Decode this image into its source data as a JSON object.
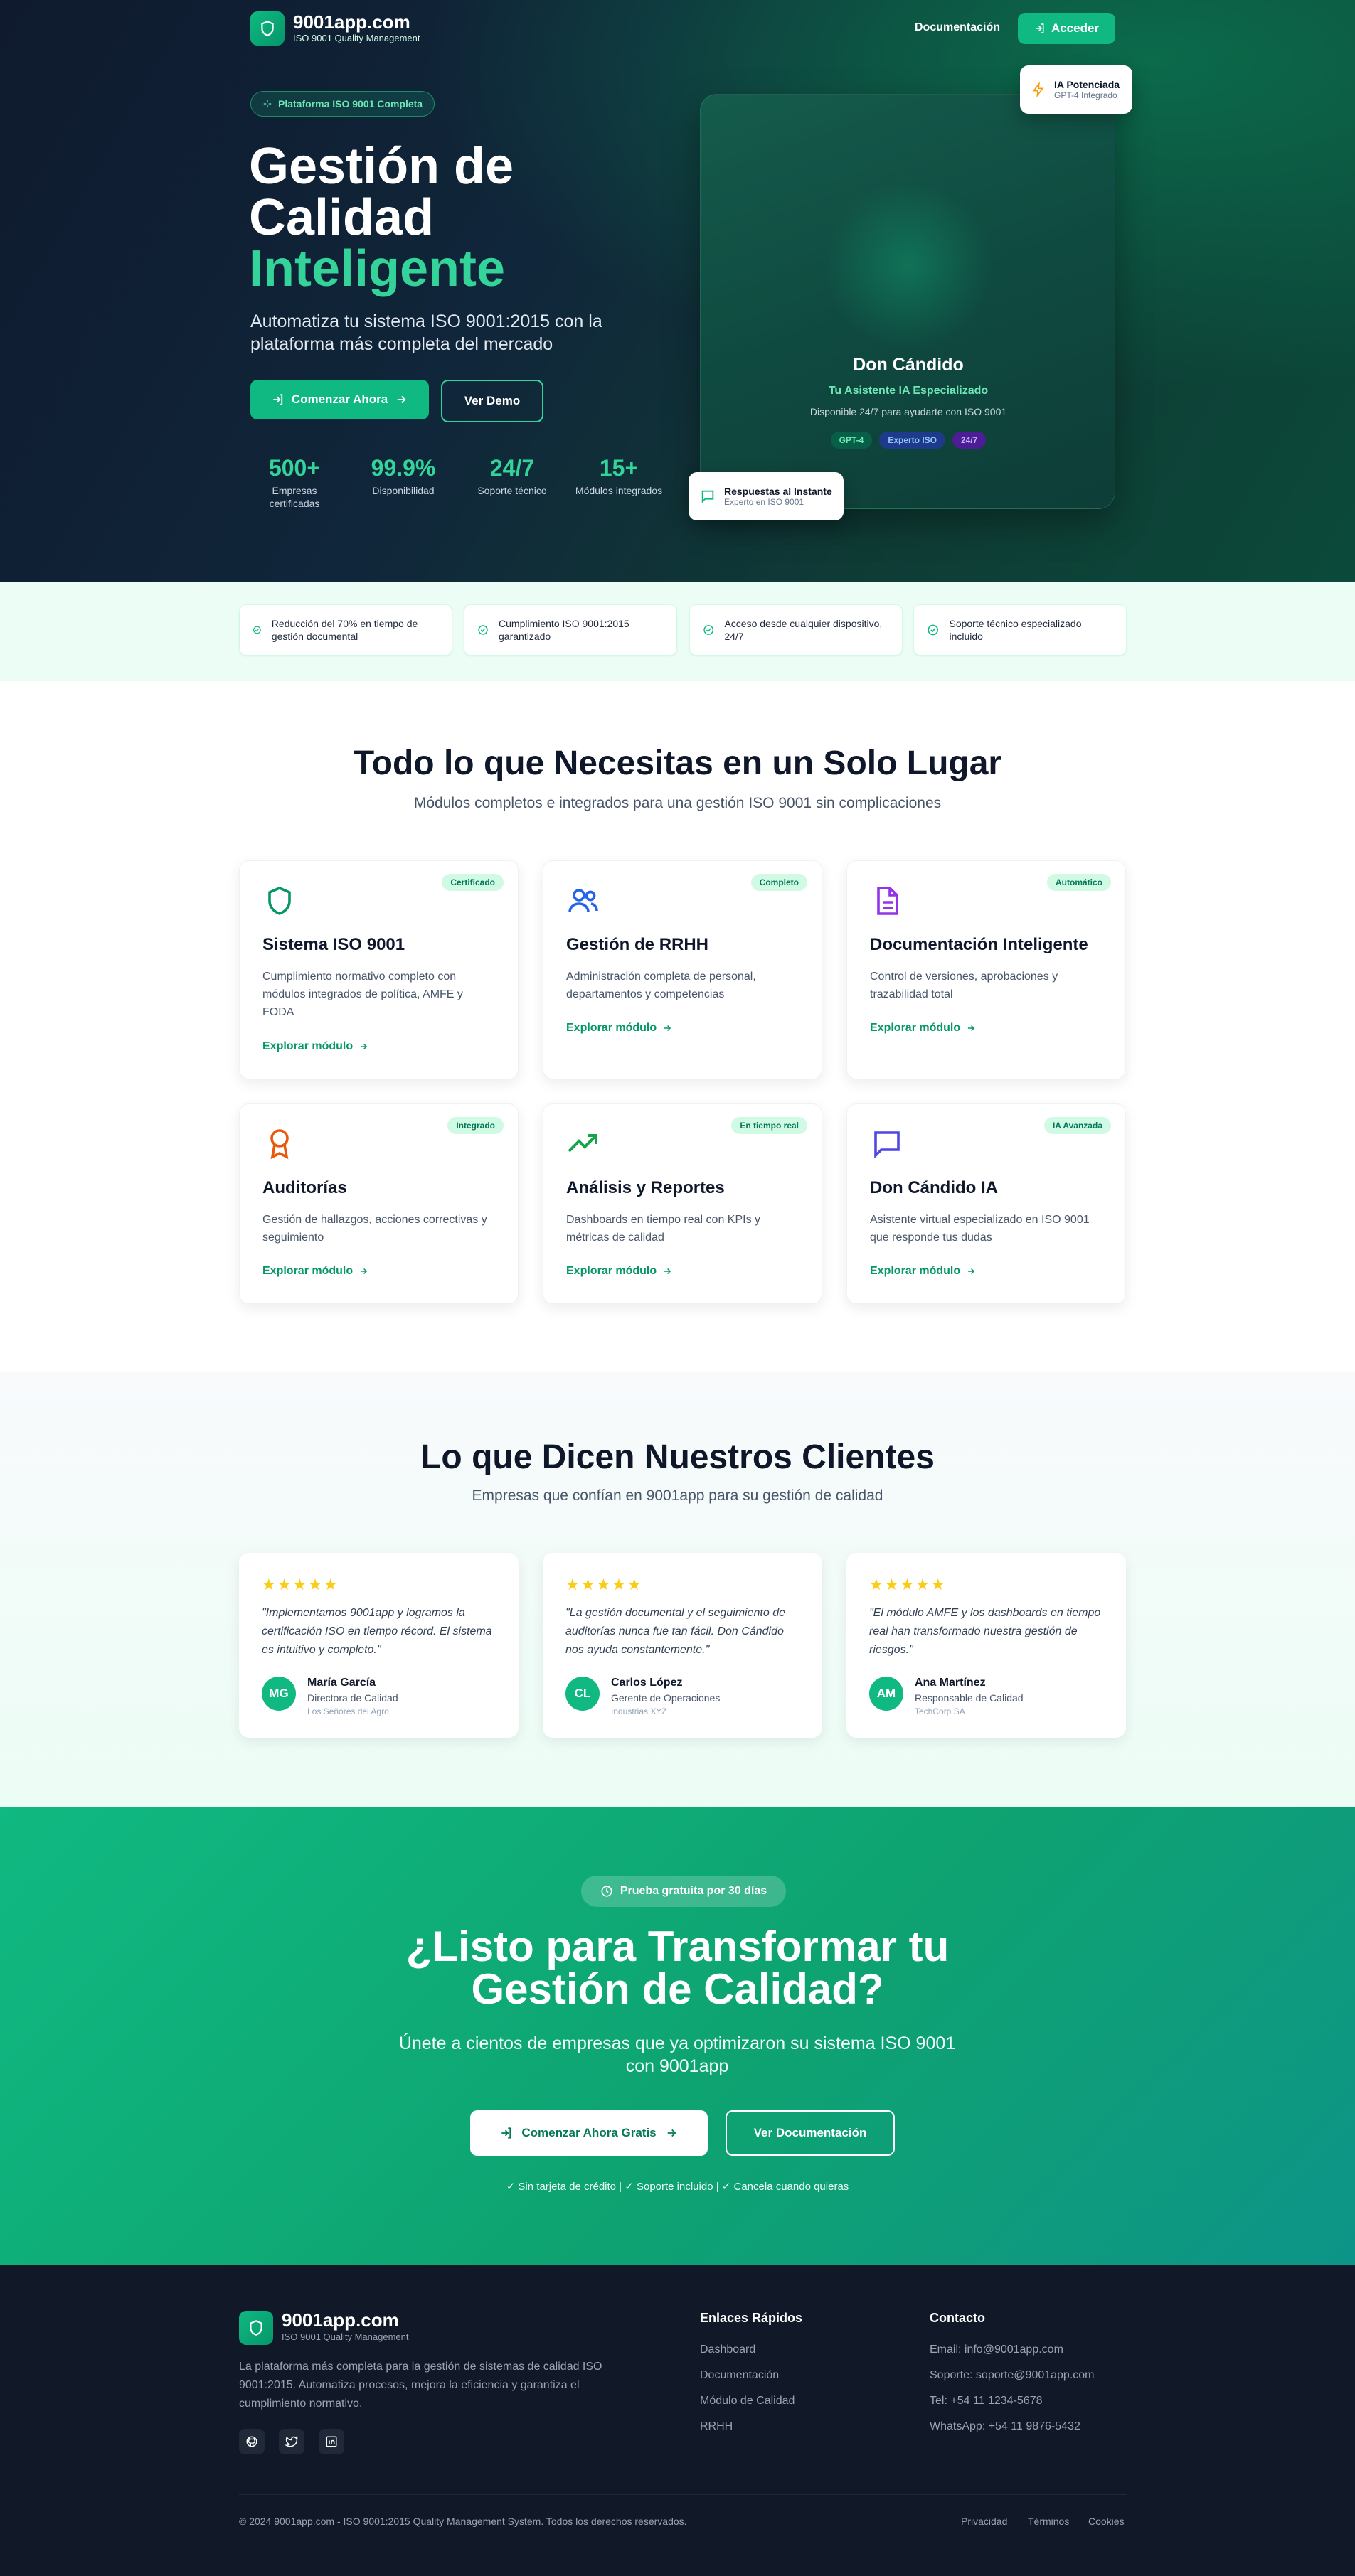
{
  "header": {
    "brand_name": "9001app.com",
    "brand_sub": "ISO 9001 Quality Management",
    "nav_docs": "Documentación",
    "login_label": "Acceder"
  },
  "hero": {
    "pill": "Plataforma ISO 9001 Completa",
    "title_line1": "Gestión de",
    "title_line2": "Calidad",
    "title_highlight": "Inteligente",
    "lead": "Automatiza tu sistema ISO 9001:2015 con la plataforma más completa del mercado",
    "cta_primary": "Comenzar Ahora",
    "cta_secondary": "Ver Demo",
    "stats": [
      {
        "value": "500+",
        "label": "Empresas certificadas"
      },
      {
        "value": "99.9%",
        "label": "Disponibilidad"
      },
      {
        "value": "24/7",
        "label": "Soporte técnico"
      },
      {
        "value": "15+",
        "label": "Módulos integrados"
      }
    ],
    "ai_card": {
      "name": "Don Cándido",
      "subtitle": "Tu Asistente IA Especializado",
      "desc": "Disponible 24/7 para ayudarte con ISO 9001",
      "tags": [
        "GPT-4",
        "Experto ISO",
        "24/7"
      ]
    },
    "badge_top": {
      "title": "IA Potenciada",
      "sub": "GPT-4 Integrado"
    },
    "badge_bottom": {
      "title": "Respuestas al Instante",
      "sub": "Experto en ISO 9001"
    }
  },
  "benefits": [
    "Reducción del 70% en tiempo de gestión documental",
    "Cumplimiento ISO 9001:2015 garantizado",
    "Acceso desde cualquier dispositivo, 24/7",
    "Soporte técnico especializado incluido"
  ],
  "modules": {
    "title": "Todo lo que Necesitas en un Solo Lugar",
    "subtitle": "Módulos completos e integrados para una gestión ISO 9001 sin complicaciones",
    "link_label": "Explorar módulo",
    "items": [
      {
        "title": "Sistema ISO 9001",
        "badge": "Certificado",
        "desc": "Cumplimiento normativo completo con módulos integrados de política, AMFE y FODA",
        "icon": "shield-icon",
        "color": "#059669"
      },
      {
        "title": "Gestión de RRHH",
        "badge": "Completo",
        "desc": "Administración completa de personal, departamentos y competencias",
        "icon": "users-icon",
        "color": "#2563eb"
      },
      {
        "title": "Documentación Inteligente",
        "badge": "Automático",
        "desc": "Control de versiones, aprobaciones y trazabilidad total",
        "icon": "document-icon",
        "color": "#9333ea"
      },
      {
        "title": "Auditorías",
        "badge": "Integrado",
        "desc": "Gestión de hallazgos, acciones correctivas y seguimiento",
        "icon": "award-icon",
        "color": "#ea580c"
      },
      {
        "title": "Análisis y Reportes",
        "badge": "En tiempo real",
        "desc": "Dashboards en tiempo real con KPIs y métricas de calidad",
        "icon": "trending-up-icon",
        "color": "#16a34a"
      },
      {
        "title": "Don Cándido IA",
        "badge": "IA Avanzada",
        "desc": "Asistente virtual especializado en ISO 9001 que responde tus dudas",
        "icon": "chat-icon",
        "color": "#4f46e5"
      }
    ]
  },
  "testimonials": {
    "title": "Lo que Dicen Nuestros Clientes",
    "subtitle": "Empresas que confían en 9001app para su gestión de calidad",
    "stars": "★★★★★",
    "items": [
      {
        "quote": "\"Implementamos 9001app y logramos la certificación ISO en tiempo récord. El sistema es intuitivo y completo.\"",
        "initials": "MG",
        "name": "María García",
        "role": "Directora de Calidad",
        "company": "Los Señores del Agro"
      },
      {
        "quote": "\"La gestión documental y el seguimiento de auditorías nunca fue tan fácil. Don Cándido nos ayuda constantemente.\"",
        "initials": "CL",
        "name": "Carlos López",
        "role": "Gerente de Operaciones",
        "company": "Industrias XYZ"
      },
      {
        "quote": "\"El módulo AMFE y los dashboards en tiempo real han transformado nuestra gestión de riesgos.\"",
        "initials": "AM",
        "name": "Ana Martínez",
        "role": "Responsable de Calidad",
        "company": "TechCorp SA"
      }
    ]
  },
  "cta": {
    "pill": "Prueba gratuita por 30 días",
    "title_line1": "¿Listo para Transformar tu",
    "title_line2": "Gestión de Calidad?",
    "text": "Únete a cientos de empresas que ya optimizaron su sistema ISO 9001 con 9001app",
    "primary": "Comenzar Ahora Gratis",
    "secondary": "Ver Documentación",
    "note": "✓ Sin tarjeta de crédito | ✓ Soporte incluido | ✓ Cancela cuando quieras"
  },
  "footer": {
    "brand_name": "9001app.com",
    "brand_sub": "ISO 9001 Quality Management",
    "desc": "La plataforma más completa para la gestión de sistemas de calidad ISO 9001:2015. Automatiza procesos, mejora la eficiencia y garantiza el cumplimiento normativo.",
    "links_title": "Enlaces Rápidos",
    "links": [
      "Dashboard",
      "Documentación",
      "Módulo de Calidad",
      "RRHH"
    ],
    "contact_title": "Contacto",
    "contact": [
      "Email: info@9001app.com",
      "Soporte: soporte@9001app.com",
      "Tel: +54 11 1234-5678",
      "WhatsApp: +54 11 9876-5432"
    ],
    "copyright": "© 2024 9001app.com - ISO 9001:2015 Quality Management System. Todos los derechos reservados.",
    "legal": [
      "Privacidad",
      "Términos",
      "Cookies"
    ],
    "social": [
      "github-icon",
      "twitter-icon",
      "linkedin-icon"
    ]
  }
}
